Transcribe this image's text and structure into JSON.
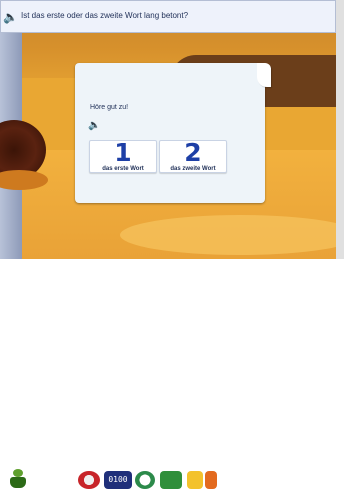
{
  "question": {
    "text": "Ist das erste oder das zweite Wort lang betont?",
    "icon": "speaker-icon"
  },
  "card": {
    "instruction": "Höre gut zu!",
    "audio_icon": "speaker-icon",
    "choices": [
      {
        "number": "1",
        "label": "das erste Wort"
      },
      {
        "number": "2",
        "label": "das zweite Wort"
      }
    ]
  },
  "toolbar": {
    "clock_text": "0100",
    "items": [
      "lamp-icon",
      "stop-icon",
      "clock-display",
      "gauge-icon",
      "green-tool-icon",
      "yellow-tool-icon",
      "arrow-icon"
    ]
  },
  "colors": {
    "background": "#e9a733",
    "card": "#eef4f9",
    "number_blue": "#1d3fa6",
    "title_text": "#1f2f57"
  }
}
